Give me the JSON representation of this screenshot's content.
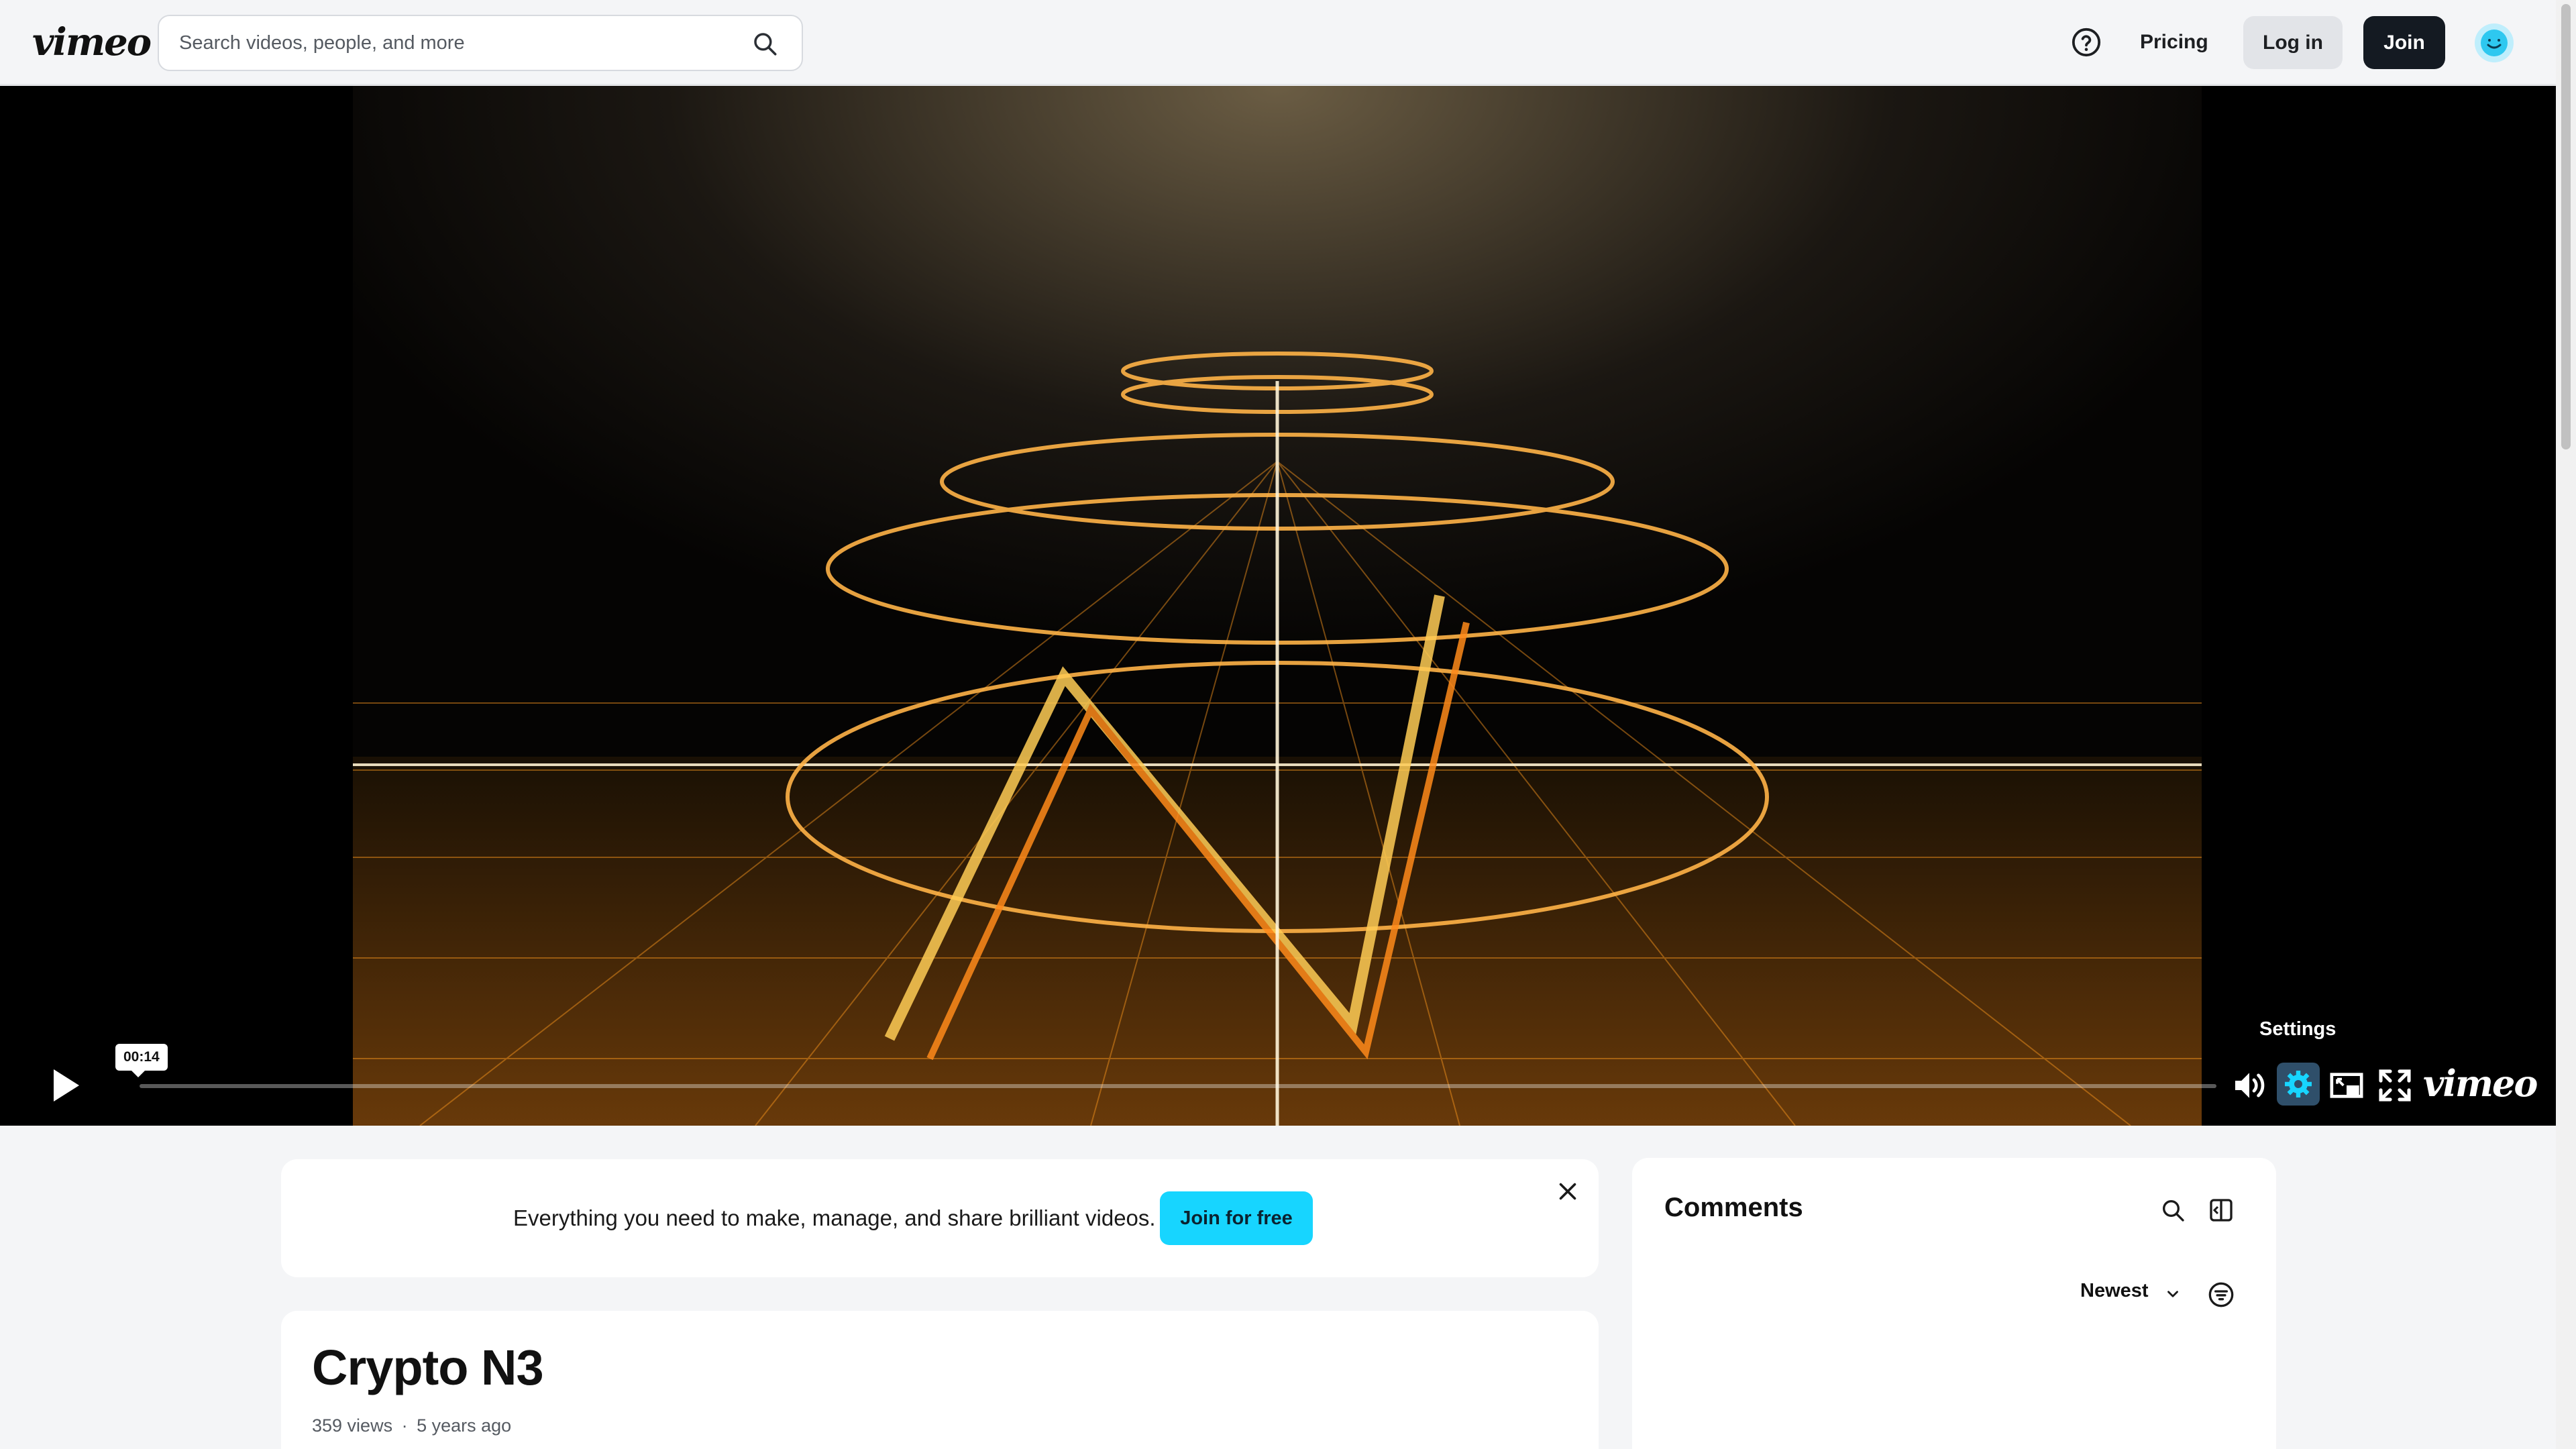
{
  "header": {
    "logo": "vimeo",
    "search": {
      "placeholder": "Search videos, people, and more",
      "value": "",
      "icon": "search-icon"
    },
    "help_icon": "help-circle-icon",
    "pricing_label": "Pricing",
    "login_label": "Log in",
    "join_label": "Join",
    "avatar_icon": "avatar-face-icon"
  },
  "player": {
    "current_time": "00:14",
    "progress": 0.0,
    "settings_tooltip": "Settings",
    "icons": [
      "play-icon",
      "volume-icon",
      "gear-icon",
      "picture-in-picture-icon",
      "fullscreen-icon"
    ],
    "logo": "vimeo",
    "accent_color": "#17d5ff"
  },
  "banner": {
    "text": "Everything you need to make, manage, and share brilliant videos.",
    "button_label": "Join for free",
    "close_icon": "close-icon"
  },
  "video": {
    "title": "Crypto N3",
    "views": "359 views",
    "separator": "·",
    "age": "5 years ago"
  },
  "comments": {
    "title": "Comments",
    "sort_label": "Newest",
    "icons": [
      "search-icon",
      "layout-panel-icon",
      "chevron-down-icon",
      "filter-icon"
    ]
  }
}
